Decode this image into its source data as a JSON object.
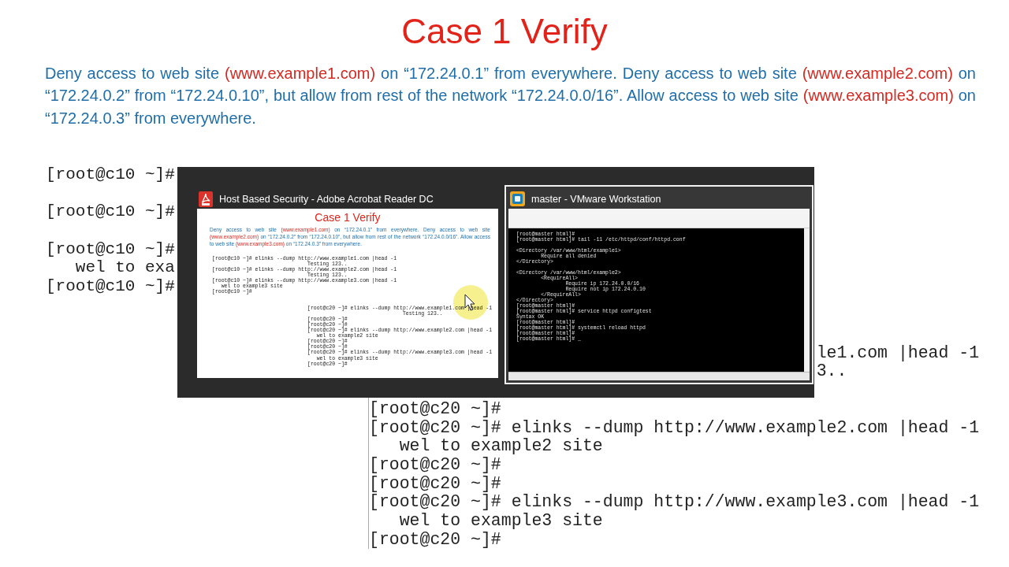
{
  "slide": {
    "title": "Case 1 Verify",
    "description": [
      {
        "text": "Deny access to web site ",
        "highlight": false
      },
      {
        "text": "(www.example1.com)",
        "highlight": true
      },
      {
        "text": " on “172.24.0.1” from everywhere. Deny access to web site ",
        "highlight": false
      },
      {
        "text": "(www.example2.com)",
        "highlight": true
      },
      {
        "text": " on “172.24.0.2” from  “172.24.0.10”, but allow from rest of the network “172.24.0.0/16”.  Allow access to web site ",
        "highlight": false
      },
      {
        "text": "(www.example3.com)",
        "highlight": true
      },
      {
        "text": " on “172.24.0.3” from everywhere.",
        "highlight": false
      }
    ],
    "terminal_left": {
      "blocks": [
        [
          {
            "kind": "prompt",
            "text": "[root@c10 ~]#"
          }
        ],
        [
          {
            "kind": "prompt",
            "text": "[root@c10 ~]#"
          }
        ],
        [
          {
            "kind": "prompt",
            "text": "[root@c10 ~]#"
          },
          {
            "kind": "output",
            "text": "wel to exa"
          },
          {
            "kind": "prompt",
            "text": "[root@c10 ~]#"
          }
        ]
      ]
    },
    "terminal_right": {
      "blocks": [
        [
          {
            "kind": "tail",
            "text": "le1.com |head -1"
          },
          {
            "kind": "tail",
            "text": "3.."
          }
        ],
        [
          {
            "kind": "prompt",
            "text": "[root@c20 ~]#"
          },
          {
            "kind": "prompt",
            "text": "[root@c20 ~]# elinks --dump http://www.example2.com |head -1"
          },
          {
            "kind": "output",
            "text": "wel to example2 site"
          },
          {
            "kind": "prompt",
            "text": "[root@c20 ~]#"
          },
          {
            "kind": "prompt",
            "text": "[root@c20 ~]#"
          },
          {
            "kind": "prompt",
            "text": "[root@c20 ~]# elinks --dump http://www.example3.com |head -1"
          },
          {
            "kind": "output",
            "text": "wel to example3 site"
          },
          {
            "kind": "prompt",
            "text": "[root@c20 ~]#"
          }
        ]
      ]
    }
  },
  "task_switcher": {
    "windows": [
      {
        "kind": "pdf",
        "title": "Host Based Security - Adobe Acrobat Reader DC",
        "selected": false,
        "preview": {
          "title": "Case 1 Verify",
          "description": [
            {
              "text": "Deny access to web site ",
              "highlight": false
            },
            {
              "text": "(www.example1.com)",
              "highlight": true
            },
            {
              "text": " on “172.24.0.1” from everywhere. Deny access to web site ",
              "highlight": false
            },
            {
              "text": "(www.example2.com)",
              "highlight": true
            },
            {
              "text": " on “172.24.0.2” from  “172.24.0.10”, but allow from rest of the network “172.24.0.0/16”.  Allow access to web site ",
              "highlight": false
            },
            {
              "text": "(www.example3.com)",
              "highlight": true
            },
            {
              "text": " on “172.24.0.3” from everywhere.",
              "highlight": false
            }
          ],
          "terminal_left": {
            "blocks": [
              [
                {
                  "kind": "prompt",
                  "text": "[root@c10 ~]# elinks --dump http://www.example1.com |head -1"
                },
                {
                  "kind": "result",
                  "text": "Testing 123.."
                },
                {
                  "kind": "prompt",
                  "text": "[root@c10 ~]# elinks --dump http://www.example2.com |head -1"
                },
                {
                  "kind": "result",
                  "text": "Testing 123.."
                },
                {
                  "kind": "prompt",
                  "text": "[root@c10 ~]# elinks --dump http://www.example3.com |head -1"
                },
                {
                  "kind": "output",
                  "text": "wel to example3 site"
                },
                {
                  "kind": "prompt",
                  "text": "[root@c10 ~]#"
                }
              ]
            ]
          },
          "terminal_right": {
            "blocks": [
              [
                {
                  "kind": "prompt",
                  "text": "[root@c20 ~]# elinks --dump http://www.example1.com |head -1"
                },
                {
                  "kind": "result",
                  "text": "Testing 123.."
                },
                {
                  "kind": "prompt",
                  "text": "[root@c20 ~]#"
                },
                {
                  "kind": "prompt",
                  "text": "[root@c20 ~]#"
                },
                {
                  "kind": "prompt",
                  "text": "[root@c20 ~]# elinks --dump http://www.example2.com |head -1"
                },
                {
                  "kind": "output",
                  "text": "wel to example2 site"
                },
                {
                  "kind": "prompt",
                  "text": "[root@c20 ~]#"
                },
                {
                  "kind": "prompt",
                  "text": "[root@c20 ~]#"
                },
                {
                  "kind": "prompt",
                  "text": "[root@c20 ~]# elinks --dump http://www.example3.com |head -1"
                },
                {
                  "kind": "output",
                  "text": "wel to example3 site"
                },
                {
                  "kind": "prompt",
                  "text": "[root@c20 ~]#"
                }
              ]
            ]
          }
        }
      },
      {
        "kind": "vm",
        "title": "master - VMware Workstation",
        "selected": true,
        "preview": {
          "console": [
            {
              "text": "[root@master html]#"
            },
            {
              "text": "[root@master html]# tail -11 /etc/httpd/conf/httpd.conf",
              "blank_after": true
            },
            {
              "text": "<Directory /var/www/html/example1>",
              "children": [
                {
                  "text": "Require all denied"
                }
              ]
            },
            {
              "text": "</Directory>",
              "blank_after": true
            },
            {
              "text": "<Directory /var/www/html/example2>",
              "children": [
                {
                  "text": "<RequireAll>",
                  "children": [
                    {
                      "text": "Require ip 172.24.0.0/16"
                    },
                    {
                      "text": "Require not ip 172.24.0.10"
                    }
                  ]
                },
                {
                  "text": "</RequireAll>"
                }
              ]
            },
            {
              "text": "</Directory>"
            },
            {
              "text": "[root@master html]#"
            },
            {
              "text": "[root@master html]# service httpd configtest"
            },
            {
              "text": "Syntax OK"
            },
            {
              "text": "[root@master html]#"
            },
            {
              "text": "[root@master html]# systemctl reload httpd"
            },
            {
              "text": "[root@master html]#"
            },
            {
              "text": "[root@master html]# _"
            }
          ]
        }
      }
    ]
  }
}
